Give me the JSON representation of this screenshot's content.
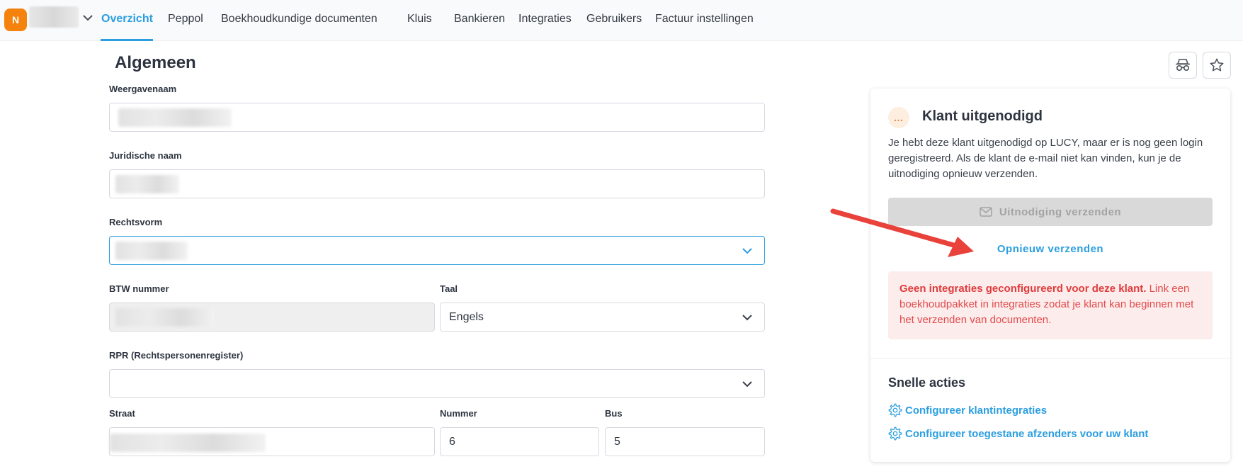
{
  "account": {
    "avatar_letter": "N"
  },
  "nav": {
    "items": [
      {
        "label": "Overzicht"
      },
      {
        "label": "Peppol"
      },
      {
        "label": "Boekhoudkundige documenten"
      },
      {
        "label": "Kluis"
      },
      {
        "label": "Bankieren"
      },
      {
        "label": "Integraties"
      },
      {
        "label": "Gebruikers"
      },
      {
        "label": "Factuur instellingen"
      }
    ]
  },
  "form": {
    "section_title": "Algemeen",
    "display_name_label": "Weergavenaam",
    "legal_name_label": "Juridische naam",
    "legal_form_label": "Rechtsvorm",
    "vat_label": "BTW nummer",
    "language_label": "Taal",
    "language_value": "Engels",
    "rpr_label": "RPR (Rechtspersonenregister)",
    "street_label": "Straat",
    "number_label": "Nummer",
    "number_value": "6",
    "bus_label": "Bus",
    "bus_value": "5"
  },
  "panel": {
    "status_icon": "…",
    "title": "Klant uitgenodigd",
    "text": "Je hebt deze klant uitgenodigd op LUCY, maar er is nog geen login geregistreerd. Als de klant de e-mail niet kan vinden, kun je de uitnodiging opnieuw verzenden.",
    "send_button": "Uitnodiging verzenden",
    "resend_link": "Opnieuw verzenden",
    "alert_bold": "Geen integraties geconfigureerd voor deze klant.",
    "alert_text": " Link een boekhoudpakket in integraties zodat je klant kan beginnen met het verzenden van documenten.",
    "quick_title": "Snelle acties",
    "quick_links": [
      {
        "label": "Configureer klantintegraties"
      },
      {
        "label": "Configureer toegestane afzenders voor uw klant"
      }
    ]
  },
  "colors": {
    "accent": "#2b9ee0",
    "avatar": "#f5820d",
    "alert_bg": "#fdecec",
    "alert_text": "#e24b4b",
    "arrow": "#e8423b"
  },
  "icons": {
    "spy": "incognito-icon",
    "star": "star-icon",
    "mail": "mail-icon",
    "gear": "gear-icon",
    "chevron": "chevron-down-icon"
  }
}
